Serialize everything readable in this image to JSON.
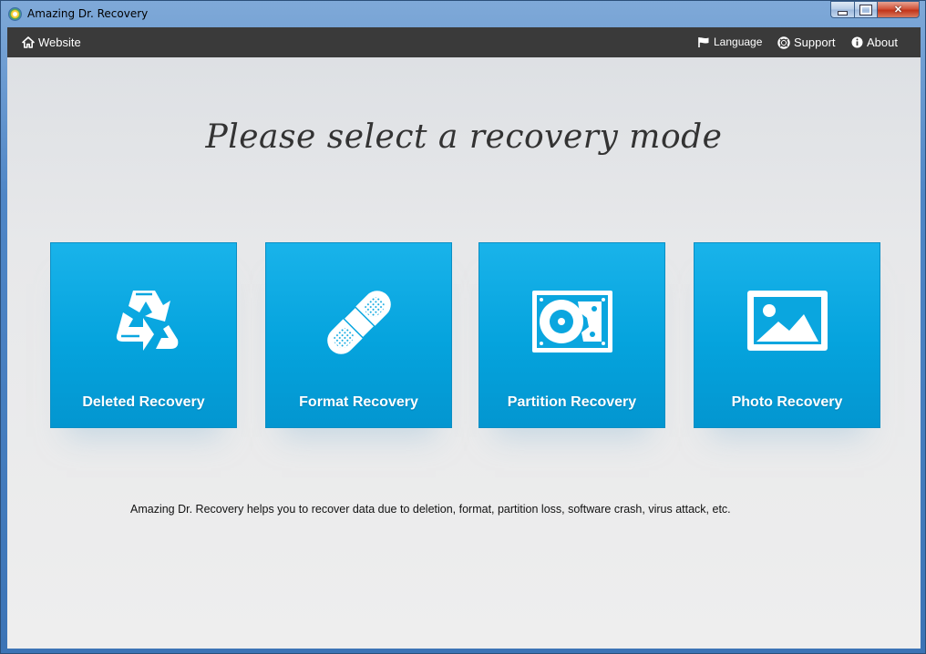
{
  "window": {
    "title": "Amazing Dr. Recovery",
    "controls": {
      "minimize_icon": "minimize-icon",
      "maximize_icon": "maximize-icon",
      "close_icon": "close-icon",
      "close_glyph": "✕"
    }
  },
  "menubar": {
    "website": {
      "label": "Website",
      "icon": "home-icon"
    },
    "language": {
      "label": "Language",
      "icon": "flag-icon"
    },
    "support": {
      "label": "Support",
      "icon": "lifebuoy-icon"
    },
    "about": {
      "label": "About",
      "icon": "info-icon"
    }
  },
  "main": {
    "heading": "Please select a recovery mode",
    "tiles": [
      {
        "label": "Deleted Recovery",
        "icon": "recycle-icon"
      },
      {
        "label": "Format Recovery",
        "icon": "bandage-icon"
      },
      {
        "label": "Partition Recovery",
        "icon": "hard-drive-icon"
      },
      {
        "label": "Photo Recovery",
        "icon": "photo-icon"
      }
    ],
    "description": "Amazing Dr. Recovery helps you to recover data due to deletion, format, partition loss, software crash, virus attack, etc."
  },
  "colors": {
    "tile": "#05a3dd",
    "menubar": "#3a3a3a",
    "title_bar": "#4f86c6"
  }
}
